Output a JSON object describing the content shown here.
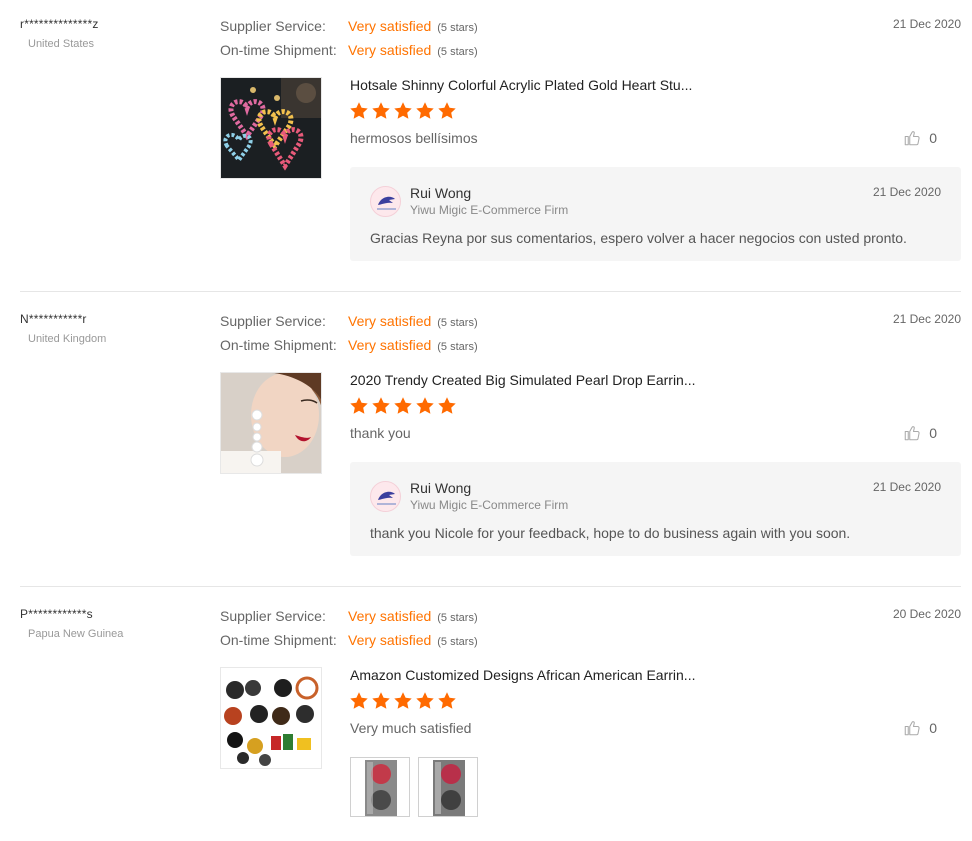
{
  "colors": {
    "accent": "#ff7300",
    "star": "#ff6a00",
    "muted": "#999999"
  },
  "reviews": [
    {
      "buyer": "r**************z",
      "country": "United States",
      "date": "21 Dec 2020",
      "supplier_service_label": "Supplier Service:",
      "supplier_service_value": "Very satisfied",
      "supplier_service_stars": "(5 stars)",
      "shipment_label": "On-time Shipment:",
      "shipment_value": "Very satisfied",
      "shipment_stars": "(5 stars)",
      "product_image_icon": "heart-earrings-thumbnail",
      "product_title": "Hotsale Shinny Colorful Acrylic Plated Gold Heart Stu...",
      "rating": 5,
      "comment": "hermosos bellísimos",
      "likes": "0",
      "reply": {
        "avatar_icon": "supplier-logo",
        "name": "Rui Wong",
        "firm": "Yiwu Migic E-Commerce Firm",
        "date": "21 Dec 2020",
        "text": "Gracias Reyna por sus comentarios, espero volver a hacer negocios con usted pronto."
      }
    },
    {
      "buyer": "N***********r",
      "country": "United Kingdom",
      "date": "21 Dec 2020",
      "supplier_service_label": "Supplier Service:",
      "supplier_service_value": "Very satisfied",
      "supplier_service_stars": "(5 stars)",
      "shipment_label": "On-time Shipment:",
      "shipment_value": "Very satisfied",
      "shipment_stars": "(5 stars)",
      "product_image_icon": "pearl-earrings-thumbnail",
      "product_title": "2020 Trendy Created Big Simulated Pearl Drop Earrin...",
      "rating": 5,
      "comment": "thank you",
      "likes": "0",
      "reply": {
        "avatar_icon": "supplier-logo",
        "name": "Rui Wong",
        "firm": "Yiwu Migic E-Commerce Firm",
        "date": "21 Dec 2020",
        "text": "thank you Nicole for your feedback, hope to do business again with you soon."
      }
    },
    {
      "buyer": "P************s",
      "country": "Papua New Guinea",
      "date": "20 Dec 2020",
      "supplier_service_label": "Supplier Service:",
      "supplier_service_value": "Very satisfied",
      "supplier_service_stars": "(5 stars)",
      "shipment_label": "On-time Shipment:",
      "shipment_value": "Very satisfied",
      "shipment_stars": "(5 stars)",
      "product_image_icon": "african-earrings-thumbnail",
      "product_title": "Amazon Customized Designs African American Earrin...",
      "rating": 5,
      "comment": "Very much satisfied",
      "likes": "0",
      "attachments": [
        "buyer-photo-1",
        "buyer-photo-2"
      ]
    }
  ]
}
